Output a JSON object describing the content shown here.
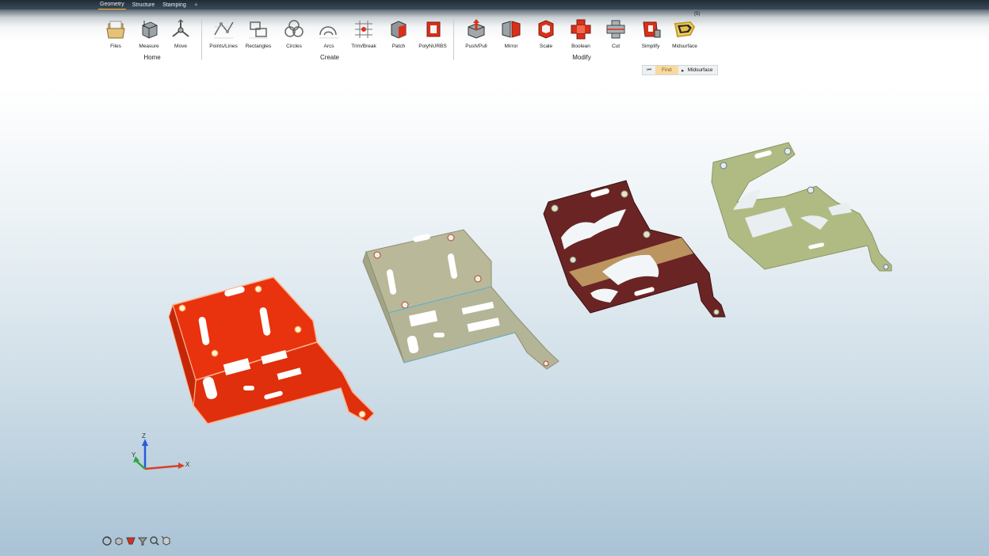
{
  "tabs": [
    "Geometry",
    "Structure",
    "Stamping",
    "+"
  ],
  "groups": {
    "home": {
      "label": "Home",
      "tools": [
        "Files",
        "Measure",
        "Move"
      ]
    },
    "create": {
      "label": "Create",
      "tools": [
        "Points/Lines",
        "Rectangles",
        "Circles",
        "Arcs",
        "Trim/Break",
        "Patch",
        "PolyNURBS"
      ]
    },
    "modify": {
      "label": "Modify",
      "tools": [
        "Push/Pull",
        "Mirror",
        "Scale",
        "Boolean",
        "Cut",
        "Simplify",
        "Midsurface"
      ]
    }
  },
  "midsurface_badge": "(5)",
  "find_bar": {
    "find_label": "Find",
    "current": "Midsurface"
  },
  "axes": {
    "x": "X",
    "y": "Y",
    "z": "Z"
  },
  "colors": {
    "part1": "#e8330e",
    "part2": "#b9b99a",
    "part3": "#6b2424",
    "part4": "#b0bb83",
    "accent": "#ffb020"
  }
}
